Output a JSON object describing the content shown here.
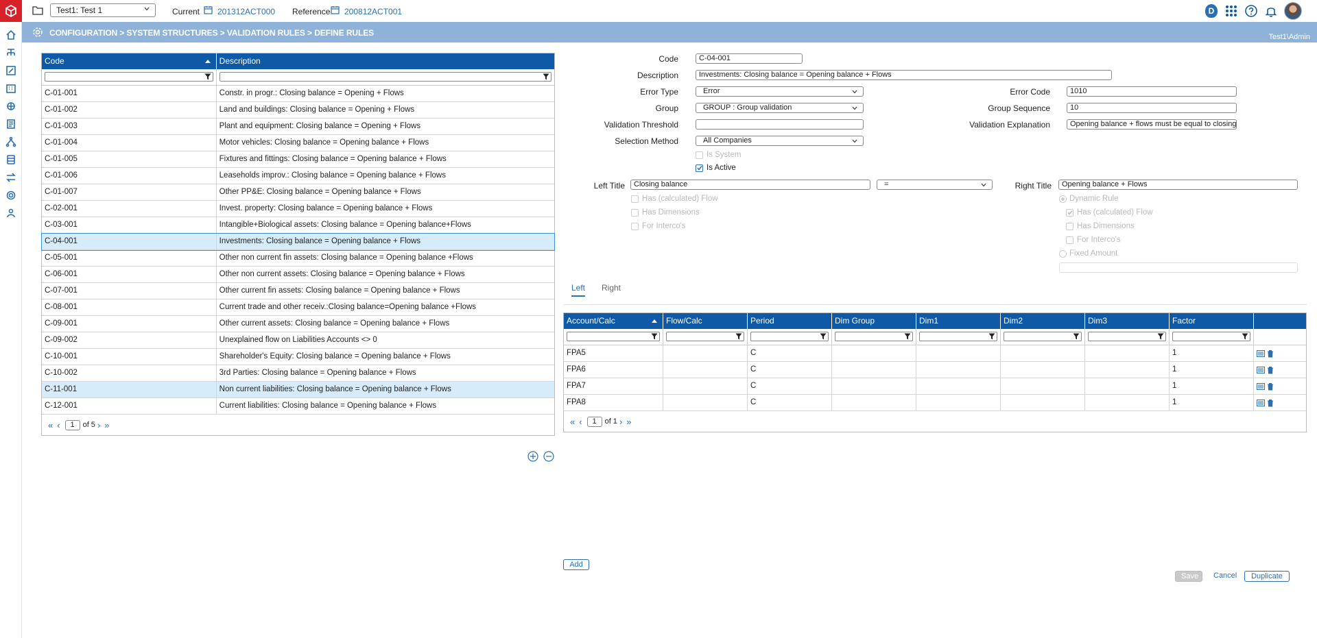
{
  "topbar": {
    "scenario": "Test1: Test 1",
    "current_label": "Current",
    "current_value": "201312ACT000",
    "reference_label": "Reference",
    "reference_value": "200812ACT001",
    "badge": "D"
  },
  "breadcrumb": "CONFIGURATION > SYSTEM STRUCTURES > VALIDATION RULES > DEFINE RULES",
  "user": "Test1\\Admin",
  "rules_table": {
    "headers": {
      "code": "Code",
      "description": "Description"
    },
    "rows": [
      {
        "code": "C-01-001",
        "description": "Constr. in progr.: Closing balance = Opening + Flows"
      },
      {
        "code": "C-01-002",
        "description": "Land and buildings: Closing balance = Opening + Flows"
      },
      {
        "code": "C-01-003",
        "description": "Plant and equipment: Closing balance = Opening + Flows"
      },
      {
        "code": "C-01-004",
        "description": "Motor vehicles: Closing balance = Opening balance + Flows"
      },
      {
        "code": "C-01-005",
        "description": "Fixtures and fittings: Closing balance = Opening balance + Flows"
      },
      {
        "code": "C-01-006",
        "description": "Leaseholds improv.: Closing balance = Opening balance + Flows"
      },
      {
        "code": "C-01-007",
        "description": "Other PP&E: Closing balance = Opening balance + Flows"
      },
      {
        "code": "C-02-001",
        "description": "Invest. property: Closing balance = Opening balance + Flows"
      },
      {
        "code": "C-03-001",
        "description": "Intangible+Biological assets: Closing balance = Opening balance+Flows"
      },
      {
        "code": "C-04-001",
        "description": "Investments: Closing balance = Opening balance + Flows"
      },
      {
        "code": "C-05-001",
        "description": "Other non current fin assets: Closing balance = Opening balance +Flows"
      },
      {
        "code": "C-06-001",
        "description": "Other non current assets: Closing balance = Opening balance + Flows"
      },
      {
        "code": "C-07-001",
        "description": "Other current fin assets: Closing balance = Opening balance + Flows"
      },
      {
        "code": "C-08-001",
        "description": "Current trade and other receiv.:Closing balance=Opening balance +Flows"
      },
      {
        "code": "C-09-001",
        "description": "Other current assets: Closing balance = Opening balance + Flows"
      },
      {
        "code": "C-09-002",
        "description": "Unexplained flow on Liabilities Accounts <> 0"
      },
      {
        "code": "C-10-001",
        "description": "Shareholder's Equity: Closing balance = Opening balance + Flows"
      },
      {
        "code": "C-10-002",
        "description": "3rd Parties: Closing balance = Opening balance + Flows"
      },
      {
        "code": "C-11-001",
        "description": "Non current liabilities: Closing balance = Opening balance + Flows"
      },
      {
        "code": "C-12-001",
        "description": "Current liabilities: Closing balance = Opening balance + Flows"
      }
    ],
    "pager": {
      "page": "1",
      "of_label": "of 5"
    }
  },
  "form": {
    "code_label": "Code",
    "code": "C-04-001",
    "description_label": "Description",
    "description": "Investments: Closing balance = Opening balance + Flows",
    "error_type_label": "Error Type",
    "error_type": "Error",
    "error_code_label": "Error Code",
    "error_code": "1010",
    "group_label": "Group",
    "group": "GROUP : Group validation",
    "group_sequence_label": "Group Sequence",
    "group_sequence": "10",
    "validation_threshold_label": "Validation Threshold",
    "validation_threshold": "",
    "validation_explanation_label": "Validation Explanation",
    "validation_explanation": "Opening balance + flows must be equal to closing",
    "selection_method_label": "Selection Method",
    "selection_method": "All Companies",
    "is_system_label": "Is System",
    "is_active_label": "Is Active",
    "left_title_label": "Left Title",
    "left_title": "Closing balance",
    "operator": "=",
    "right_title_label": "Right Title",
    "right_title": "Opening balance + Flows",
    "left_has_calc_flow": "Has (calculated) Flow",
    "left_has_dimensions": "Has Dimensions",
    "left_for_intercos": "For Interco's",
    "dynamic_rule": "Dynamic Rule",
    "right_has_calc_flow": "Has (calculated) Flow",
    "right_has_dimensions": "Has Dimensions",
    "right_for_intercos": "For Interco's",
    "fixed_amount": "Fixed Amount"
  },
  "tabs": {
    "left": "Left",
    "right": "Right"
  },
  "calc_table": {
    "headers": [
      "Account/Calc",
      "Flow/Calc",
      "Period",
      "Dim Group",
      "Dim1",
      "Dim2",
      "Dim3",
      "Factor"
    ],
    "rows": [
      {
        "account": "FPA5",
        "flow": "",
        "period": "C",
        "dimgroup": "",
        "dim1": "",
        "dim2": "",
        "dim3": "",
        "factor": "1"
      },
      {
        "account": "FPA6",
        "flow": "",
        "period": "C",
        "dimgroup": "",
        "dim1": "",
        "dim2": "",
        "dim3": "",
        "factor": "1"
      },
      {
        "account": "FPA7",
        "flow": "",
        "period": "C",
        "dimgroup": "",
        "dim1": "",
        "dim2": "",
        "dim3": "",
        "factor": "1"
      },
      {
        "account": "FPA8",
        "flow": "",
        "period": "C",
        "dimgroup": "",
        "dim1": "",
        "dim2": "",
        "dim3": "",
        "factor": "1"
      }
    ],
    "pager": {
      "page": "1",
      "of_label": "of 1"
    }
  },
  "buttons": {
    "add": "Add",
    "save": "Save",
    "cancel": "Cancel",
    "duplicate": "Duplicate"
  },
  "colors": {
    "header_blue": "#0e5aa7",
    "crumb_blue": "#8fb3d8",
    "brand_red": "#d8222a",
    "link_blue": "#2a6fb0",
    "selected_row": "#d6ecfa"
  },
  "icons": [
    "home-icon",
    "org-icon",
    "edit-icon",
    "building-icon",
    "consolidation-icon",
    "report-icon",
    "hierarchy-icon",
    "database-icon",
    "transfer-icon",
    "settings-icon",
    "users-icon"
  ]
}
